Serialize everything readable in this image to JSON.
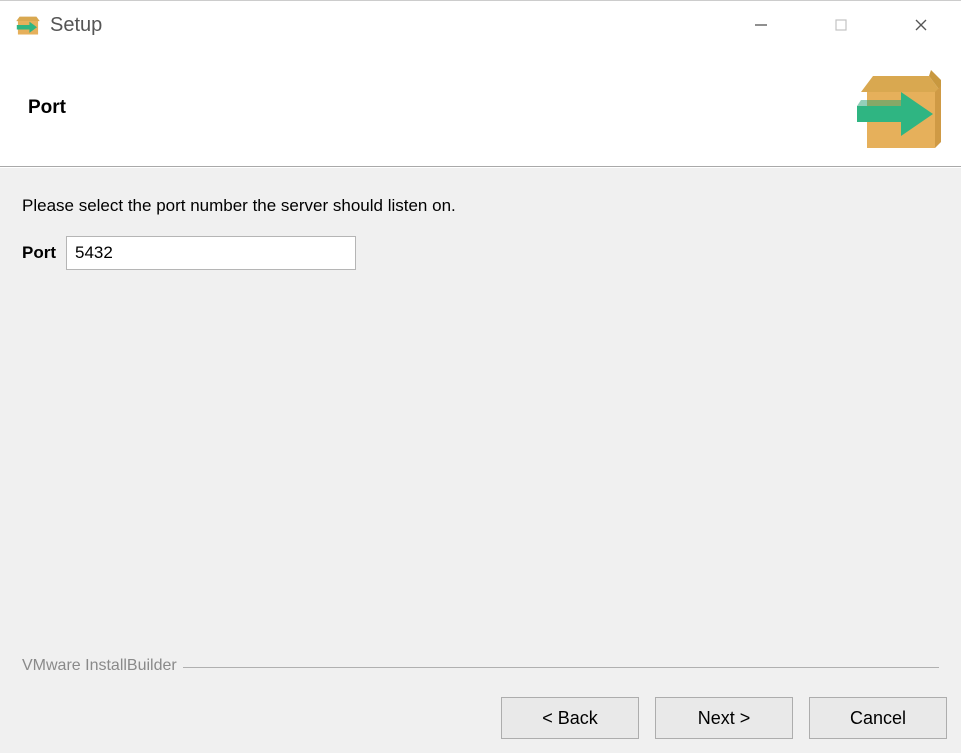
{
  "titlebar": {
    "title": "Setup"
  },
  "header": {
    "heading": "Port"
  },
  "body": {
    "instruction": "Please select the port number the server should listen on.",
    "port_label": "Port",
    "port_value": "5432"
  },
  "branding": "VMware InstallBuilder",
  "footer": {
    "back": "< Back",
    "next": "Next >",
    "cancel": "Cancel"
  }
}
